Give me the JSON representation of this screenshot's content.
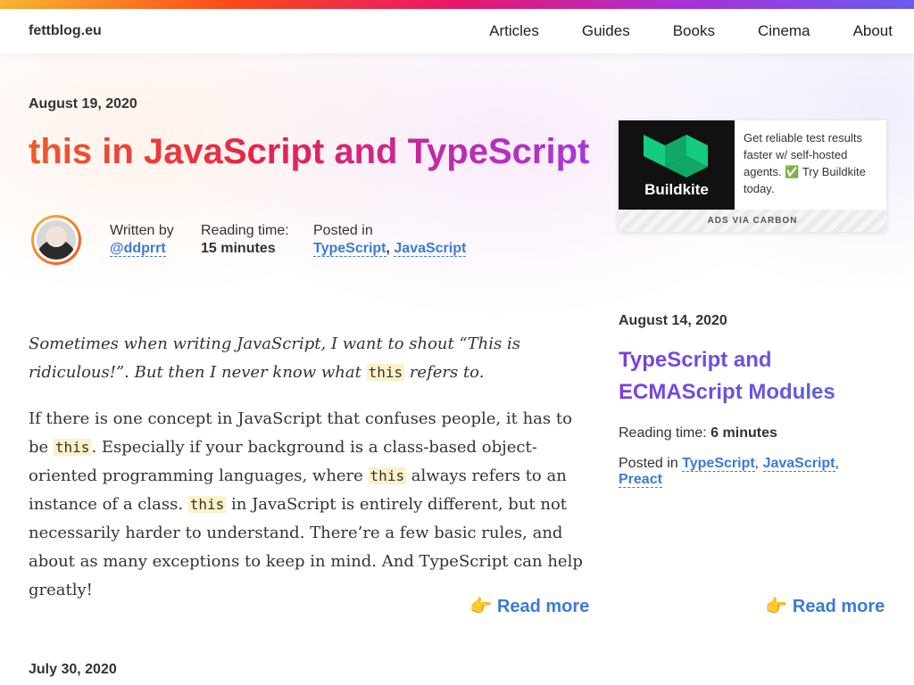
{
  "header": {
    "brand": "fettblog.eu",
    "nav": [
      "Articles",
      "Guides",
      "Books",
      "Cinema",
      "About"
    ]
  },
  "main_post": {
    "date": "August 19, 2020",
    "title": "this in JavaScript and TypeScript",
    "written_by_label": "Written by",
    "author": "@ddprrt",
    "reading_label": "Reading time:",
    "reading_time": "15 minutes",
    "posted_label": "Posted in",
    "tags": [
      "TypeScript",
      "JavaScript"
    ],
    "lead_1": "Sometimes when writing JavaScript, I want to shout “This is ridiculous!”. But then I never know what ",
    "lead_code": "this",
    "lead_2": " refers to.",
    "p_1": "If there is one concept in JavaScript that confuses people, it has to be ",
    "p_code_1": "this",
    "p_2": ". Especially if your background is a class-based object-oriented programming languages, where ",
    "p_code_2": "this",
    "p_3": " always refers to an instance of a class. ",
    "p_code_3": "this",
    "p_4": " in JavaScript is entirely different, but not necessarily harder to understand. There’re a few basic rules, and about as many exceptions to keep in mind. And TypeScript can help greatly!",
    "read_more": "Read more"
  },
  "ad": {
    "brand": "Buildkite",
    "text": "Get reliable test results faster w/ self-hosted agents. ✅ Try Buildkite today.",
    "footer": "ADS VIA CARBON",
    "logo_color": "#14cc80"
  },
  "side_post": {
    "date": "August 14, 2020",
    "title": "TypeScript and ECMAScript Modules",
    "reading_label": "Reading time:",
    "reading_time": "6 minutes",
    "posted_label": "Posted in",
    "tags": [
      "TypeScript",
      "JavaScript",
      "Preact"
    ],
    "read_more": "Read more"
  },
  "next_post": {
    "date": "July 30, 2020"
  },
  "icons": {
    "read_more": "pointing-hand-icon"
  },
  "colors": {
    "link": "#3a7bd5",
    "code_bg": "#fdf1c7"
  }
}
